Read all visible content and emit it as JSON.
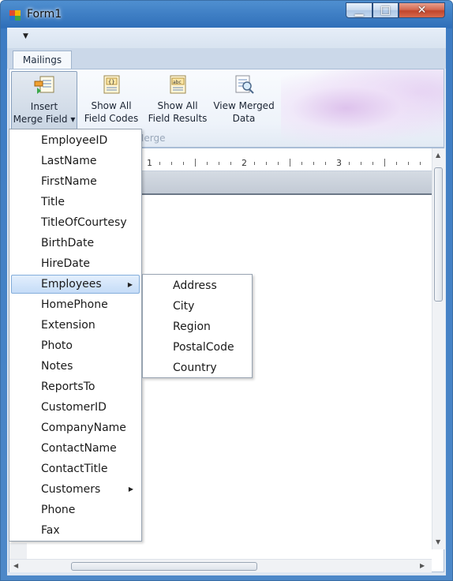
{
  "window": {
    "title": "Form1",
    "min_glyph": "▁",
    "max_glyph": "□",
    "close_glyph": "✕"
  },
  "qat": {
    "dropdown_glyph": "▼"
  },
  "ribbon": {
    "tab": "Mailings",
    "group_label": "Merge",
    "buttons": [
      {
        "line1": "Insert",
        "line2": "Merge Field",
        "dropdown": "▾"
      },
      {
        "line1": "Show All",
        "line2": "Field Codes"
      },
      {
        "line1": "Show All",
        "line2": "Field Results"
      },
      {
        "line1": "View Merged",
        "line2": "Data"
      }
    ]
  },
  "ruler": {
    "numbers": [
      "1",
      "2",
      "3"
    ]
  },
  "menu": {
    "items": [
      "EmployeeID",
      "LastName",
      "FirstName",
      "Title",
      "TitleOfCourtesy",
      "BirthDate",
      "HireDate",
      "Employees",
      "HomePhone",
      "Extension",
      "Photo",
      "Notes",
      "ReportsTo",
      "CustomerID",
      "CompanyName",
      "ContactName",
      "ContactTitle",
      "Customers",
      "Phone",
      "Fax"
    ],
    "submenu_caret": "▶",
    "selected": "Employees",
    "submenu_items": [
      "Address",
      "City",
      "Region",
      "PostalCode",
      "Country"
    ]
  },
  "colors": {
    "titlebar": "#3d7cc3",
    "menu_highlight": "#c5dcf7",
    "close_button": "#c0452c"
  },
  "icons": {
    "app": "form-app-icon",
    "insert_merge_field": "insert-merge-field-icon",
    "field_codes": "field-codes-icon",
    "field_results": "field-results-icon",
    "view_merged": "view-merged-data-icon"
  }
}
